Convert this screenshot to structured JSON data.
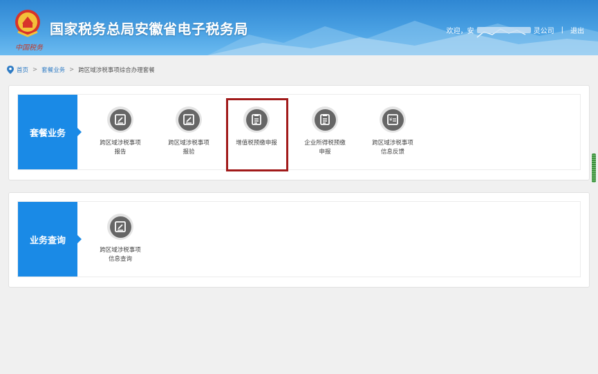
{
  "header": {
    "title": "国家税务总局安徽省电子税务局",
    "brand_script": "中国税务",
    "welcome": "欢迎，安",
    "company_suffix": "灵公司",
    "divider": "|",
    "logout": "退出"
  },
  "breadcrumb": {
    "home": "首页",
    "sep1": ">",
    "section": "套餐业务",
    "sep2": ">",
    "current": "跨区域涉税事项综合办理套餐"
  },
  "package_panel": {
    "label": "套餐业务",
    "items": [
      {
        "label": "跨区域涉税事项\n报告",
        "icon": "pen-doc-icon"
      },
      {
        "label": "跨区域涉税事项\n报验",
        "icon": "pen-doc-icon"
      },
      {
        "label": "增值税预缴申报",
        "icon": "form-doc-icon",
        "highlighted": true
      },
      {
        "label": "企业所得税预缴\n申报",
        "icon": "form-doc-icon"
      },
      {
        "label": "跨区域涉税事项\n信息反馈",
        "icon": "yuan-doc-icon"
      }
    ]
  },
  "query_panel": {
    "label": "业务查询",
    "items": [
      {
        "label": "跨区域涉税事项\n信息查询",
        "icon": "pen-doc-icon"
      }
    ]
  },
  "colors": {
    "accent": "#1a8ae6",
    "highlight_border": "#a11a1a",
    "icon_disc": "#666666"
  }
}
